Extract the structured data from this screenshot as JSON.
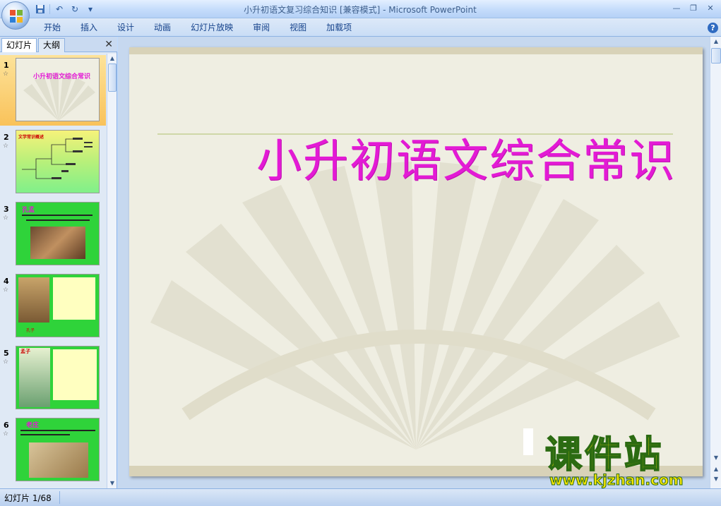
{
  "window": {
    "title": "小升初语文复习综合知识 [兼容模式] - Microsoft PowerPoint"
  },
  "qat": {
    "items": [
      "save-icon",
      "undo-icon",
      "redo-icon",
      "customize-icon"
    ]
  },
  "ribbon": {
    "tabs": [
      "开始",
      "插入",
      "设计",
      "动画",
      "幻灯片放映",
      "审阅",
      "视图",
      "加载项"
    ]
  },
  "pane": {
    "tabs": [
      "幻灯片",
      "大纲"
    ],
    "active_tab": "幻灯片",
    "thumbnails": [
      {
        "number": "1",
        "title": "小升初语文综合常识",
        "selected": true
      },
      {
        "number": "2",
        "title": "文学常识概述",
        "selected": false
      },
      {
        "number": "3",
        "title": "孔孟",
        "selected": false
      },
      {
        "number": "4",
        "title": "孔子",
        "selected": false
      },
      {
        "number": "5",
        "title": "孟子",
        "selected": false
      },
      {
        "number": "6",
        "title": "老庄",
        "selected": false
      }
    ]
  },
  "slide": {
    "title": "小升初语文综合常识",
    "colors": {
      "title": "#e31ad5",
      "background": "#efeee2"
    }
  },
  "watermark": {
    "main": "课件站",
    "url": "www.kjzhan.com"
  },
  "status": {
    "slide_indicator": "幻灯片 1/68"
  }
}
